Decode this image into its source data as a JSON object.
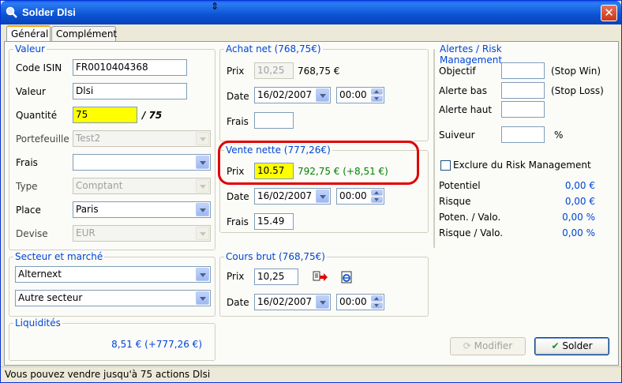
{
  "window": {
    "title": "Solder Dlsi"
  },
  "tabs": [
    "Général",
    "Complément"
  ],
  "valeur": {
    "title": "Valeur",
    "code_isin_label": "Code ISIN",
    "code_isin": "FR0010404368",
    "valeur_label": "Valeur",
    "valeur": "Dlsi",
    "quantite_label": "Quantité",
    "quantite": "75",
    "quantite_total": "/ 75",
    "portefeuille_label": "Portefeuille",
    "portefeuille": "Test2",
    "frais_label": "Frais",
    "frais": "",
    "type_label": "Type",
    "type": "Comptant",
    "place_label": "Place",
    "place": "Paris",
    "devise_label": "Devise",
    "devise": "EUR"
  },
  "secteur": {
    "title": "Secteur et marché",
    "marche": "Alternext",
    "secteur": "Autre secteur"
  },
  "liquidites": {
    "title": "Liquidités",
    "value": "8,51 € (+777,26 €)"
  },
  "achat": {
    "title": "Achat net (768,75€)",
    "prix_label": "Prix",
    "prix": "10,25",
    "prix_total": "768,75 €",
    "date_label": "Date",
    "date": "16/02/2007",
    "time": "00:00",
    "frais_label": "Frais",
    "frais": ""
  },
  "vente": {
    "title": "Vente nette (777,26€)",
    "prix_label": "Prix",
    "prix": "10.57",
    "prix_total": "792,75 € (+8,51 €)",
    "date_label": "Date",
    "date": "16/02/2007",
    "time": "00:00",
    "frais_label": "Frais",
    "frais": "15.49"
  },
  "cours": {
    "title": "Cours brut (768,75€)",
    "prix_label": "Prix",
    "prix": "10,25",
    "date_label": "Date",
    "date": "16/02/2007",
    "time": "00:00"
  },
  "alertes": {
    "title": "Alertes / Risk Management",
    "objectif_label": "Objectif",
    "objectif_hint": "(Stop Win)",
    "alerte_bas_label": "Alerte bas",
    "alerte_bas_hint": "(Stop Loss)",
    "alerte_haut_label": "Alerte haut",
    "suiveur_label": "Suiveur",
    "suiveur_unit": "%",
    "exclure_label": "Exclure du Risk Management",
    "potentiel_label": "Potentiel",
    "potentiel": "0,00 €",
    "risque_label": "Risque",
    "risque": "0,00 €",
    "poten_valo_label": "Poten. / Valo.",
    "poten_valo": "0,00 %",
    "risque_valo_label": "Risque / Valo.",
    "risque_valo": "0,00 %"
  },
  "buttons": {
    "modifier": "Modifier",
    "solder": "Solder"
  },
  "status": "Vous pouvez vendre jusqu'à 75 actions Dlsi"
}
